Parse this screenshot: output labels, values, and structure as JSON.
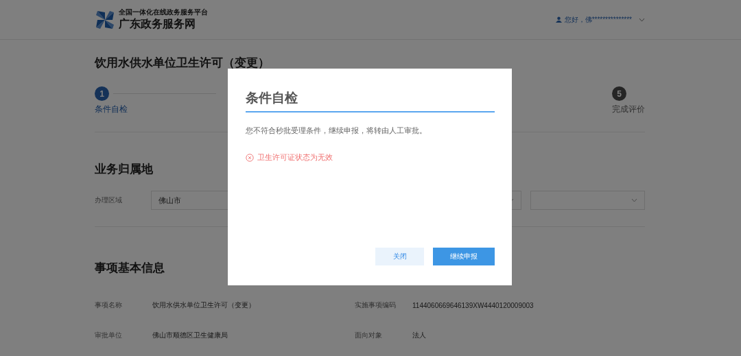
{
  "header": {
    "platform": "全国一体化在线政务服务平台",
    "site_name": "广东政务服务网",
    "greeting": "您好，佛***************"
  },
  "page_title": "饮用水供水单位卫生许可（变更）",
  "steps": [
    {
      "number": "1",
      "label": "条件自检",
      "selected": true
    },
    {
      "number": "5",
      "label": "完成评价",
      "selected": false
    }
  ],
  "region_section": {
    "title": "业务归属地",
    "label": "办理区域",
    "selects": [
      {
        "kind": "dropdown",
        "value": "佛山市"
      },
      {
        "kind": "dropdown"
      },
      {
        "kind": "dropdown"
      }
    ]
  },
  "info_section": {
    "title": "事项基本信息",
    "rows": [
      {
        "label": "事项名称",
        "value": "饮用水供水单位卫生许可（变更）",
        "label_2": "实施事项编码",
        "value_2": "1144060669646139XW4440120009003"
      },
      {
        "label": "审批单位",
        "value": "佛山市顺德区卫生健康局",
        "label_2": "面向对象",
        "value_2": "法人"
      }
    ]
  },
  "dialog": {
    "title": "条件自检",
    "message": "您不符合秒批受理条件，继续申报，将转由人工审批。",
    "errors": [
      {
        "text": "卫生许可证状态为无效"
      }
    ],
    "buttons": [
      {
        "label": "关闭",
        "kind": "secondary"
      },
      {
        "label": "继续申报",
        "kind": "primary"
      }
    ]
  }
}
